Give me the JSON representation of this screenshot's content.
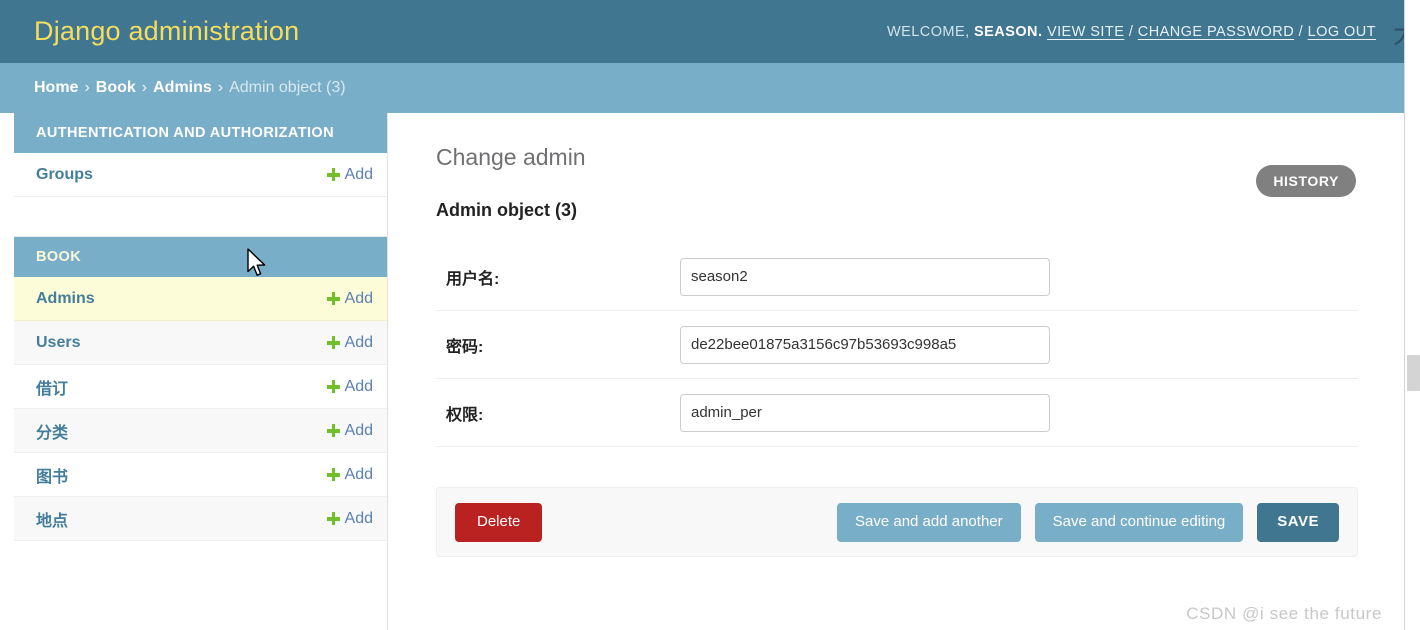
{
  "header": {
    "site_name": "Django administration",
    "welcome_prefix": "WELCOME,",
    "username": "SEASON.",
    "links": [
      {
        "label": "VIEW SITE"
      },
      {
        "label": "CHANGE PASSWORD"
      },
      {
        "label": "LOG OUT"
      }
    ],
    "separator": "/",
    "edge_glyph": "大"
  },
  "breadcrumbs": {
    "items": [
      {
        "label": "Home",
        "current": false
      },
      {
        "label": "Book",
        "current": false
      },
      {
        "label": "Admins",
        "current": false
      },
      {
        "label": "Admin object (3)",
        "current": true
      }
    ],
    "separator": "›"
  },
  "sidebar": {
    "apps": [
      {
        "caption": "AUTHENTICATION AND AUTHORIZATION",
        "models": [
          {
            "name": "Groups",
            "add_label": "Add"
          }
        ]
      },
      {
        "caption": "BOOK",
        "models": [
          {
            "name": "Admins",
            "add_label": "Add"
          },
          {
            "name": "Users",
            "add_label": "Add"
          },
          {
            "name": "借订",
            "add_label": "Add"
          },
          {
            "name": "分类",
            "add_label": "Add"
          },
          {
            "name": "图书",
            "add_label": "Add"
          },
          {
            "name": "地点",
            "add_label": "Add"
          }
        ]
      }
    ]
  },
  "content": {
    "title": "Change admin",
    "subtitle": "Admin object (3)",
    "history_label": "HISTORY",
    "form_rows": [
      {
        "label": "用户名:",
        "value": "season2",
        "placeholder": ""
      },
      {
        "label": "密码:",
        "value": "de22bee01875a3156c97b53693c998a5",
        "placeholder": ""
      },
      {
        "label": "权限:",
        "value": "admin_per",
        "placeholder": ""
      }
    ],
    "submit_row": {
      "delete_label": "Delete",
      "save_add_another_label": "Save and add another",
      "save_continue_label": "Save and continue editing",
      "save_label": "SAVE"
    }
  },
  "watermark": "CSDN @i see the future",
  "colors": {
    "header_bg": "#417690",
    "breadcrumb_bg": "#79aec8",
    "brand_yellow": "#f5dd5d",
    "link_blue": "#447e9b",
    "add_green": "#70bf2b",
    "delete_red": "#ba2121",
    "selected_row": "#fdfcd8",
    "history_gray": "#808080"
  }
}
